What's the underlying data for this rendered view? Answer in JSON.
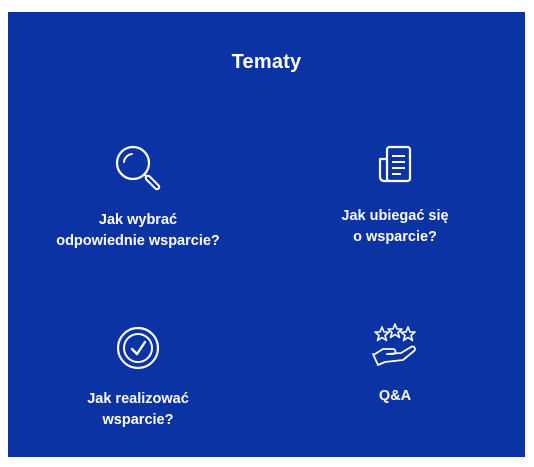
{
  "title": "Tematy",
  "colors": {
    "background": "#0b33a3",
    "text": "#ffffff"
  },
  "topics": [
    {
      "label_line1": "Jak wybrać",
      "label_line2": "odpowiednie wsparcie?",
      "icon": "magnifier-icon"
    },
    {
      "label_line1": "Jak ubiegać się",
      "label_line2": "o wsparcie?",
      "icon": "document-icon"
    },
    {
      "label_line1": "Jak realizować",
      "label_line2": "wsparcie?",
      "icon": "clock-check-icon"
    },
    {
      "label_line1": "Q&A",
      "label_line2": "",
      "icon": "stars-hand-icon"
    }
  ]
}
